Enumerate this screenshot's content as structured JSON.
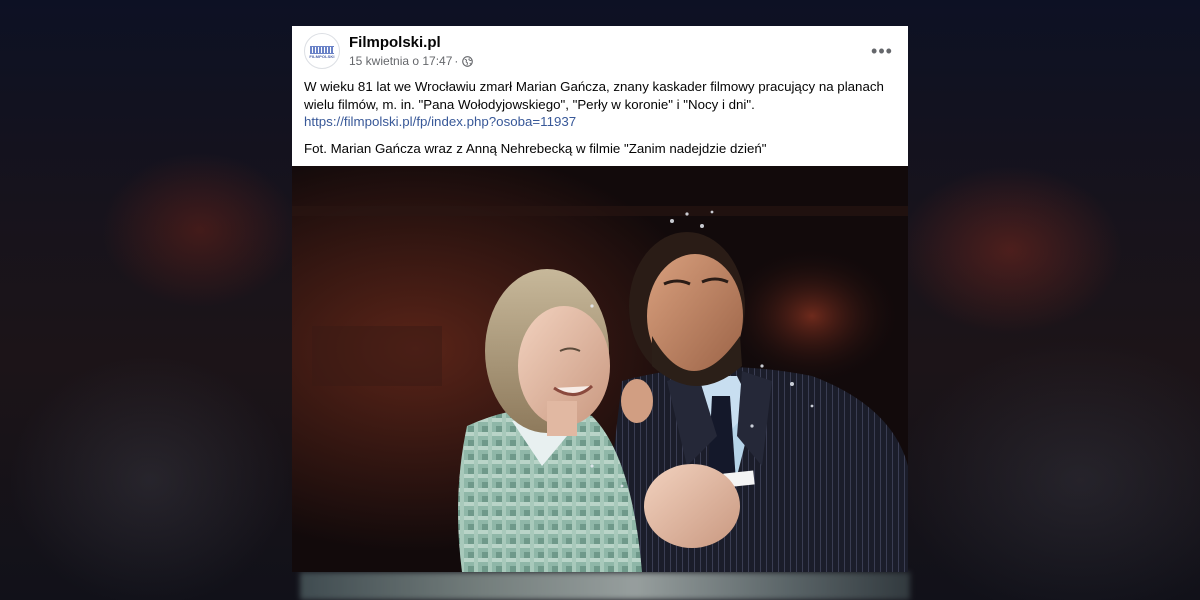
{
  "post": {
    "page_name": "Filmpolski.pl",
    "avatar_text": "FILMPOLSKI",
    "timestamp": "15 kwietnia o 17:47",
    "separator": "·",
    "privacy_icon": "globe-icon",
    "more_icon": "more-options-icon",
    "more_label": "•••",
    "text_line": "W wieku 81 lat we Wrocławiu zmarł Marian Gańcza, znany kaskader filmowy pracujący na planach wielu filmów, m. in. \"Pana Wołodyjowskiego\", \"Perły w koronie\" i \"Nocy i dni\".",
    "link": "https://filmpolski.pl/fp/index.php?osoba=11937",
    "caption": "Fot. Marian Gańcza wraz z Anną Nehrebecką w filmie \"Zanim nadejdzie dzień\""
  },
  "colors": {
    "link": "#385898",
    "secondary_text": "#65676b",
    "primary_text": "#050505"
  }
}
